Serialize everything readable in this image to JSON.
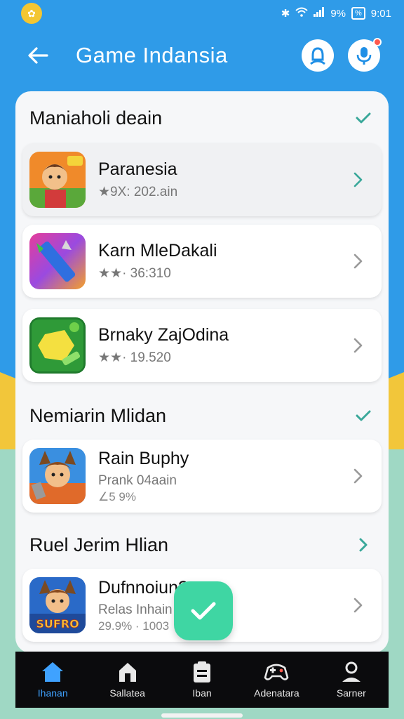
{
  "status_bar": {
    "app_icon": "app-notification-icon",
    "battery_label": "%",
    "percent": "9%",
    "time": "9:01"
  },
  "app_bar": {
    "title": "Game Indansia",
    "back_icon": "arrow-left-icon",
    "profile_icon": "user-icon",
    "mic_icon": "microphone-icon"
  },
  "sections": [
    {
      "title": "Maniaholi deain",
      "games": [
        {
          "title": "Paranesia",
          "subtitle": "★9X: 202.ain"
        },
        {
          "title": "Karn MleDakali",
          "subtitle": "★★· 36:310"
        },
        {
          "title": "Brnaky ZajOdina",
          "subtitle": "★★· 19.520"
        }
      ]
    },
    {
      "title": "Nemiarin Mlidan",
      "games": [
        {
          "title": "Rain Buphy",
          "subtitle": "Prank 04aain",
          "subtitle2": "∠5 9%"
        }
      ]
    },
    {
      "title": "Ruel Jerim Hlian",
      "games": [
        {
          "title": "Dufnnoiun?",
          "subtitle": "Relas Inhain",
          "subtitle2": "29.9% · 1003",
          "thumb_text": "SUFRO"
        }
      ]
    }
  ],
  "bottom_nav": [
    {
      "label": "Ihanan",
      "icon": "home-icon",
      "active": true
    },
    {
      "label": "Sallatea",
      "icon": "store-icon",
      "active": false
    },
    {
      "label": "Iban",
      "icon": "clipboard-icon",
      "active": false
    },
    {
      "label": "Adenatara",
      "icon": "gamepad-icon",
      "active": false
    },
    {
      "label": "Sarner",
      "icon": "person-icon",
      "active": false
    }
  ],
  "colors": {
    "accent": "#2f9be8",
    "fab": "#3fd6a3",
    "check": "#3aa89a",
    "nav_active": "#3fa2ff"
  }
}
